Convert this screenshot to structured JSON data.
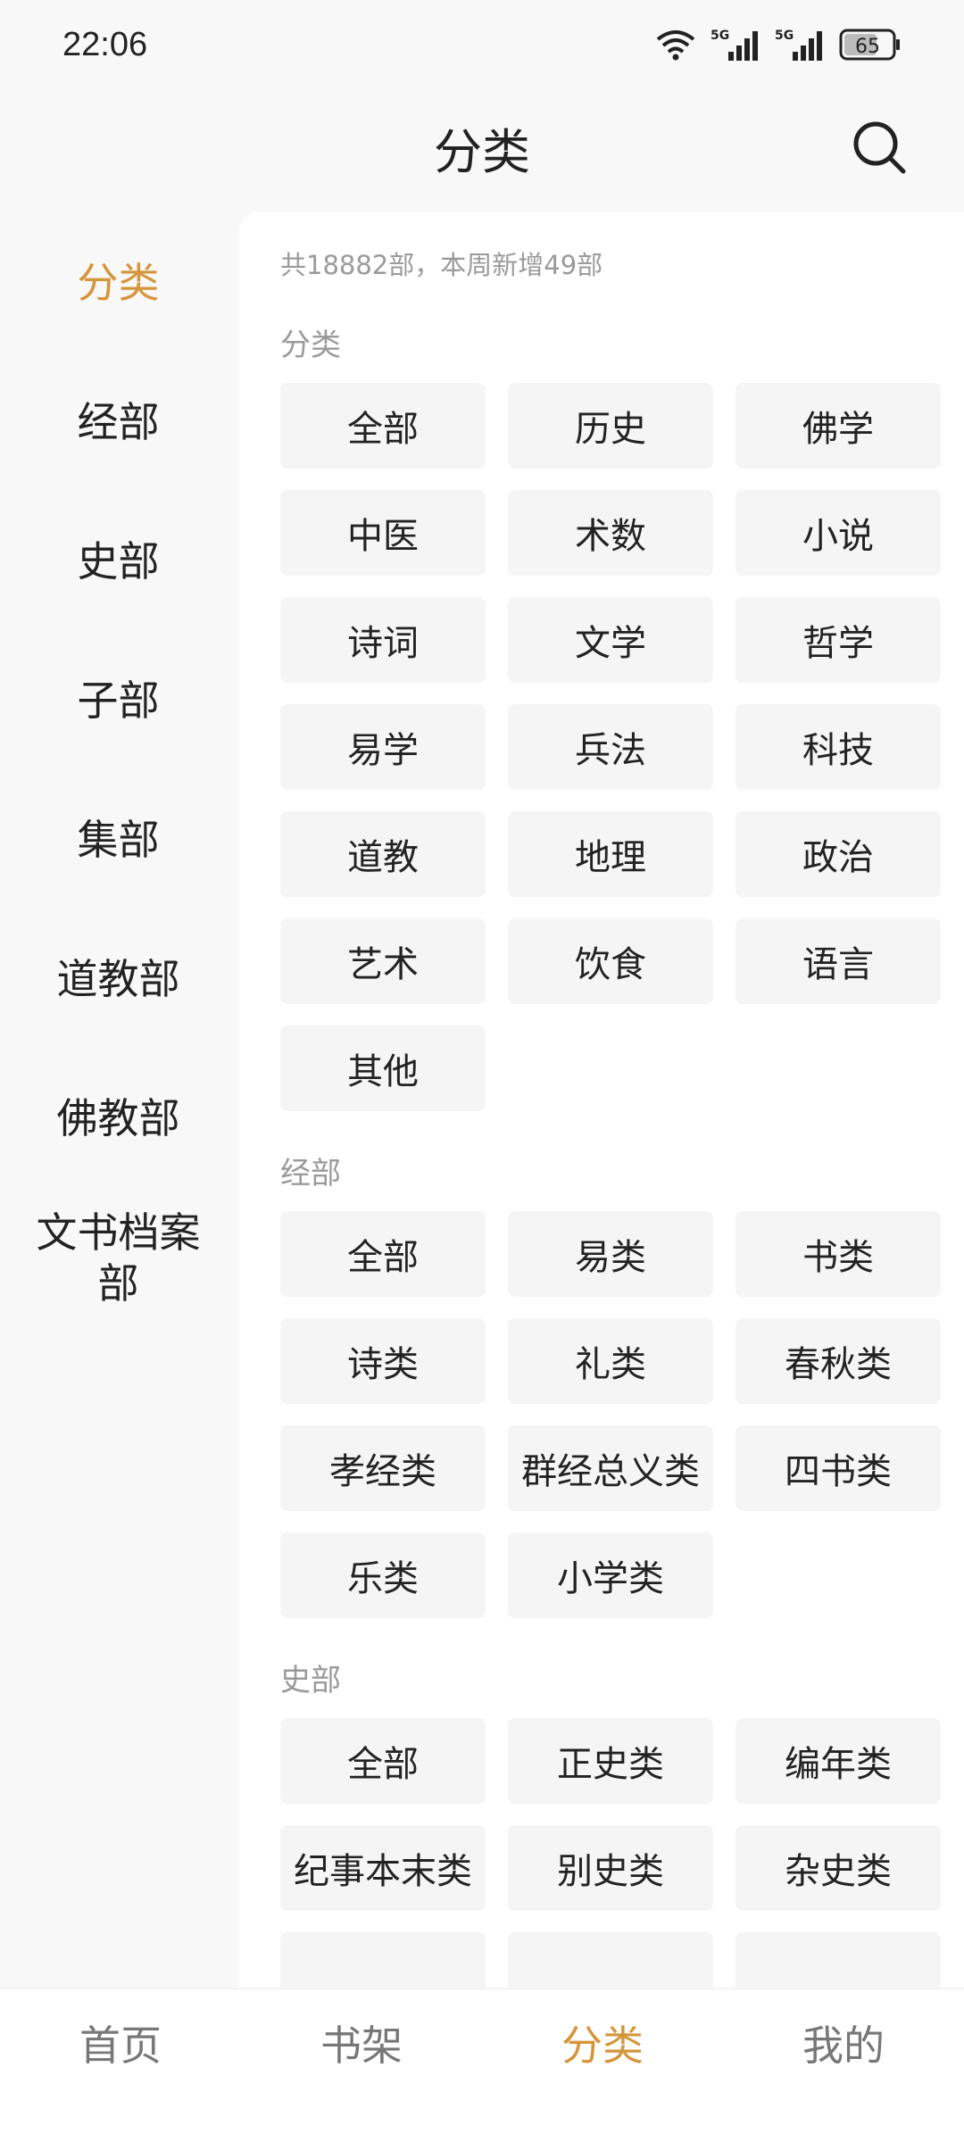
{
  "status_bar": {
    "time": "22:06",
    "signal1": "5G",
    "signal2": "5G",
    "battery": "65"
  },
  "header": {
    "title": "分类",
    "search_icon": "search-icon"
  },
  "sidebar": {
    "items": [
      {
        "label": "分类",
        "active": true
      },
      {
        "label": "经部"
      },
      {
        "label": "史部"
      },
      {
        "label": "子部"
      },
      {
        "label": "集部"
      },
      {
        "label": "道教部"
      },
      {
        "label": "佛教部"
      },
      {
        "label": "文书档案部"
      }
    ]
  },
  "content": {
    "total_text": "共18882部，本周新增49部",
    "sections": [
      {
        "title": "分类",
        "items": [
          "全部",
          "历史",
          "佛学",
          "中医",
          "术数",
          "小说",
          "诗词",
          "文学",
          "哲学",
          "易学",
          "兵法",
          "科技",
          "道教",
          "地理",
          "政治",
          "艺术",
          "饮食",
          "语言",
          "其他"
        ]
      },
      {
        "title": "经部",
        "items": [
          "全部",
          "易类",
          "书类",
          "诗类",
          "礼类",
          "春秋类",
          "孝经类",
          "群经总义类",
          "四书类",
          "乐类",
          "小学类"
        ]
      },
      {
        "title": "史部",
        "items": [
          "全部",
          "正史类",
          "编年类",
          "纪事本末类",
          "别史类",
          "杂史类"
        ]
      }
    ]
  },
  "bottom_nav": {
    "items": [
      {
        "label": "首页"
      },
      {
        "label": "书架"
      },
      {
        "label": "分类",
        "active": true
      },
      {
        "label": "我的"
      }
    ]
  },
  "colors": {
    "accent": "#d4953b",
    "text": "#222222",
    "muted": "#9a9a9a",
    "chip_bg": "#f5f5f5"
  }
}
